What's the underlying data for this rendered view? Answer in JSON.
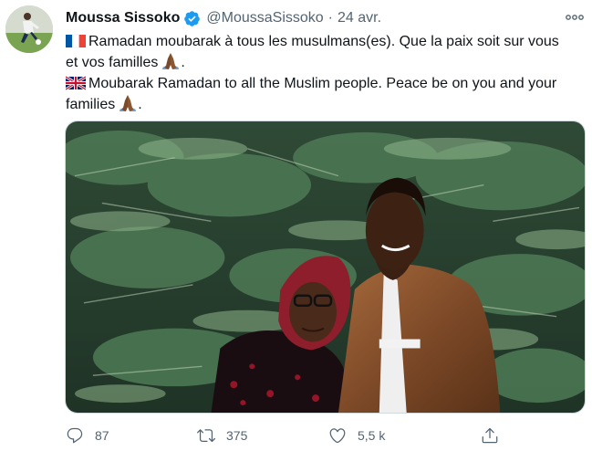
{
  "tweet": {
    "author_name": "Moussa Sissoko",
    "handle": "@MoussaSissoko",
    "separator": "·",
    "date": "24 avr.",
    "line1_fr": "Ramadan moubarak à tous les musulmans(es). Que la paix soit sur vous",
    "line2_fr": "et vos familles",
    "line3_en": "Moubarak Ramadan to all the Muslim people. Peace be on you and your",
    "line4_en_start": "families",
    "period": ".",
    "replies": "87",
    "retweets": "375",
    "likes": "5,5 k"
  },
  "icons": {
    "avatar": "avatar-player-photo",
    "verified": "verified-badge-icon",
    "more": "more-options-icon",
    "flag_fr": "france-flag-icon",
    "flag_uk": "uk-flag-icon",
    "pray": "folded-hands-icon",
    "reply": "reply-icon",
    "retweet": "retweet-icon",
    "like": "heart-icon",
    "share": "share-icon"
  },
  "colors": {
    "verified": "#1d9bf0",
    "secondary_text": "#536471"
  }
}
